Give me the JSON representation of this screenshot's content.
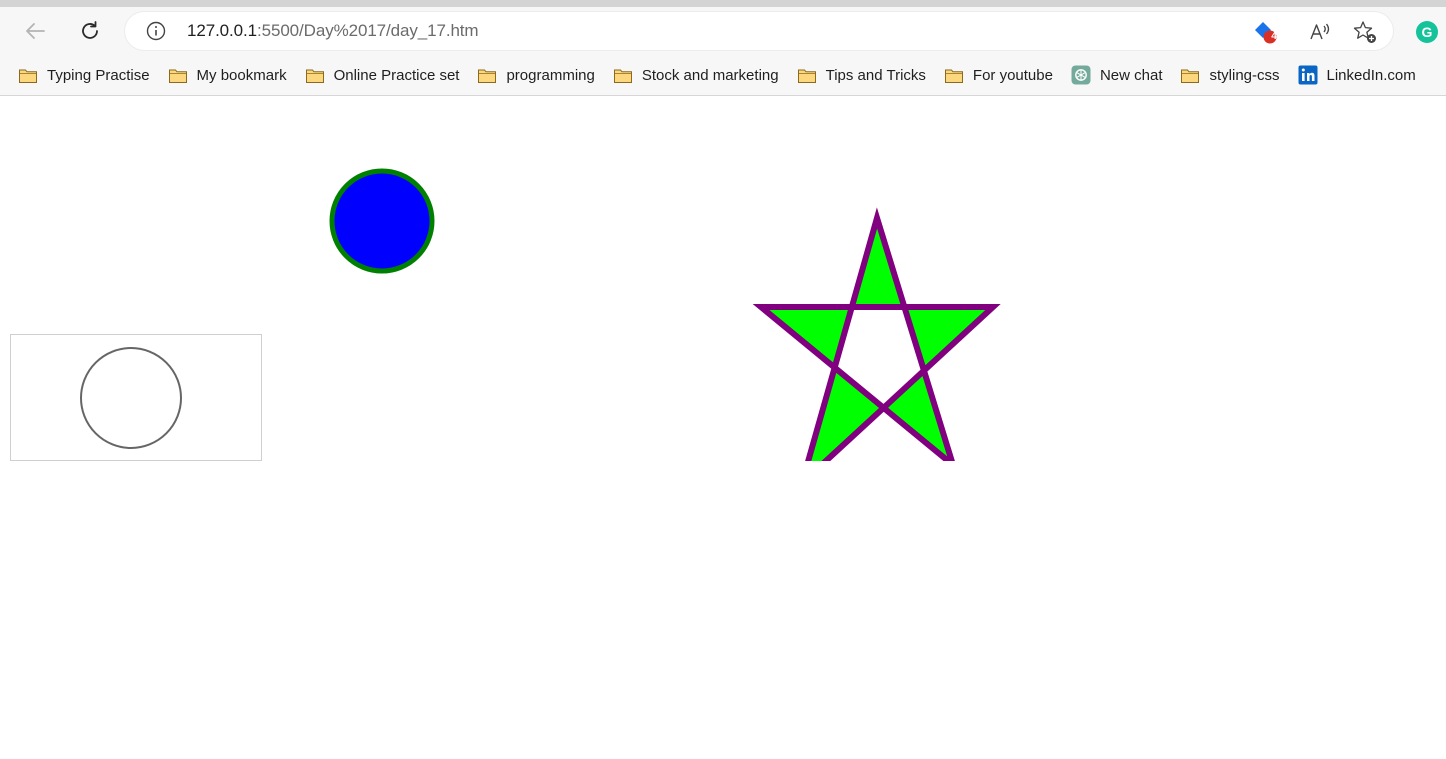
{
  "browser": {
    "url_host": "127.0.0.1",
    "url_rest": ":5500/Day%2017/day_17.htm",
    "extension_badge": "4",
    "read_aloud_icon": "read-aloud-icon",
    "favorites_icon": "favorites-star-icon",
    "profile_initial": "G"
  },
  "bookmarks": [
    {
      "label": "Typing Practise",
      "icon": "folder-icon"
    },
    {
      "label": "My bookmark",
      "icon": "folder-icon"
    },
    {
      "label": "Online Practice set",
      "icon": "folder-icon"
    },
    {
      "label": "programming",
      "icon": "folder-icon"
    },
    {
      "label": "Stock and marketing",
      "icon": "folder-icon"
    },
    {
      "label": "Tips and Tricks",
      "icon": "folder-icon"
    },
    {
      "label": "For youtube",
      "icon": "folder-icon"
    },
    {
      "label": "New chat",
      "icon": "chatgpt-icon"
    },
    {
      "label": "styling-css",
      "icon": "folder-icon"
    },
    {
      "label": "LinkedIn.com",
      "icon": "linkedin-icon"
    }
  ],
  "colors": {
    "circle_fill": "#0000ff",
    "circle_stroke": "#008000",
    "star_fill": "#00ff00",
    "star_stroke": "#800080",
    "canvas_circle_stroke": "#666666",
    "folder": "#fcd77e",
    "badge": "#d93025",
    "profile": "#15c39a"
  }
}
